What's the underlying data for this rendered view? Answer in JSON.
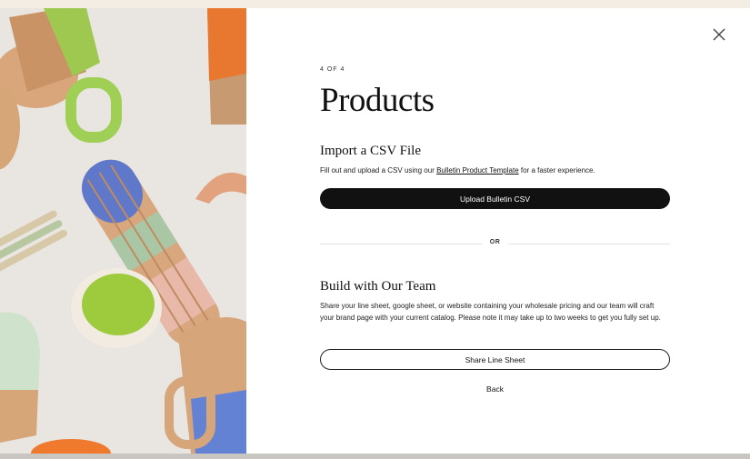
{
  "modal": {
    "step_label": "4 OF 4",
    "title": "Products",
    "close_icon": "close-icon"
  },
  "csv": {
    "heading": "Import a CSV File",
    "desc_before": "Fill out and upload a CSV using our ",
    "template_link": "Bulletin Product Template",
    "desc_after": " for a faster experience.",
    "upload_button": "Upload Bulletin CSV"
  },
  "divider": {
    "label": "OR"
  },
  "team": {
    "heading": "Build with Our Team",
    "description": "Share your line sheet, google sheet, or website containing your wholesale pricing and our team will craft your brand page with your current catalog. Please note it may take up to two weeks to get you fully set up.",
    "share_button": "Share Line Sheet",
    "back_link": "Back"
  },
  "colors": {
    "primary_button": "#111111",
    "overlay_background": "#f3ede3"
  }
}
